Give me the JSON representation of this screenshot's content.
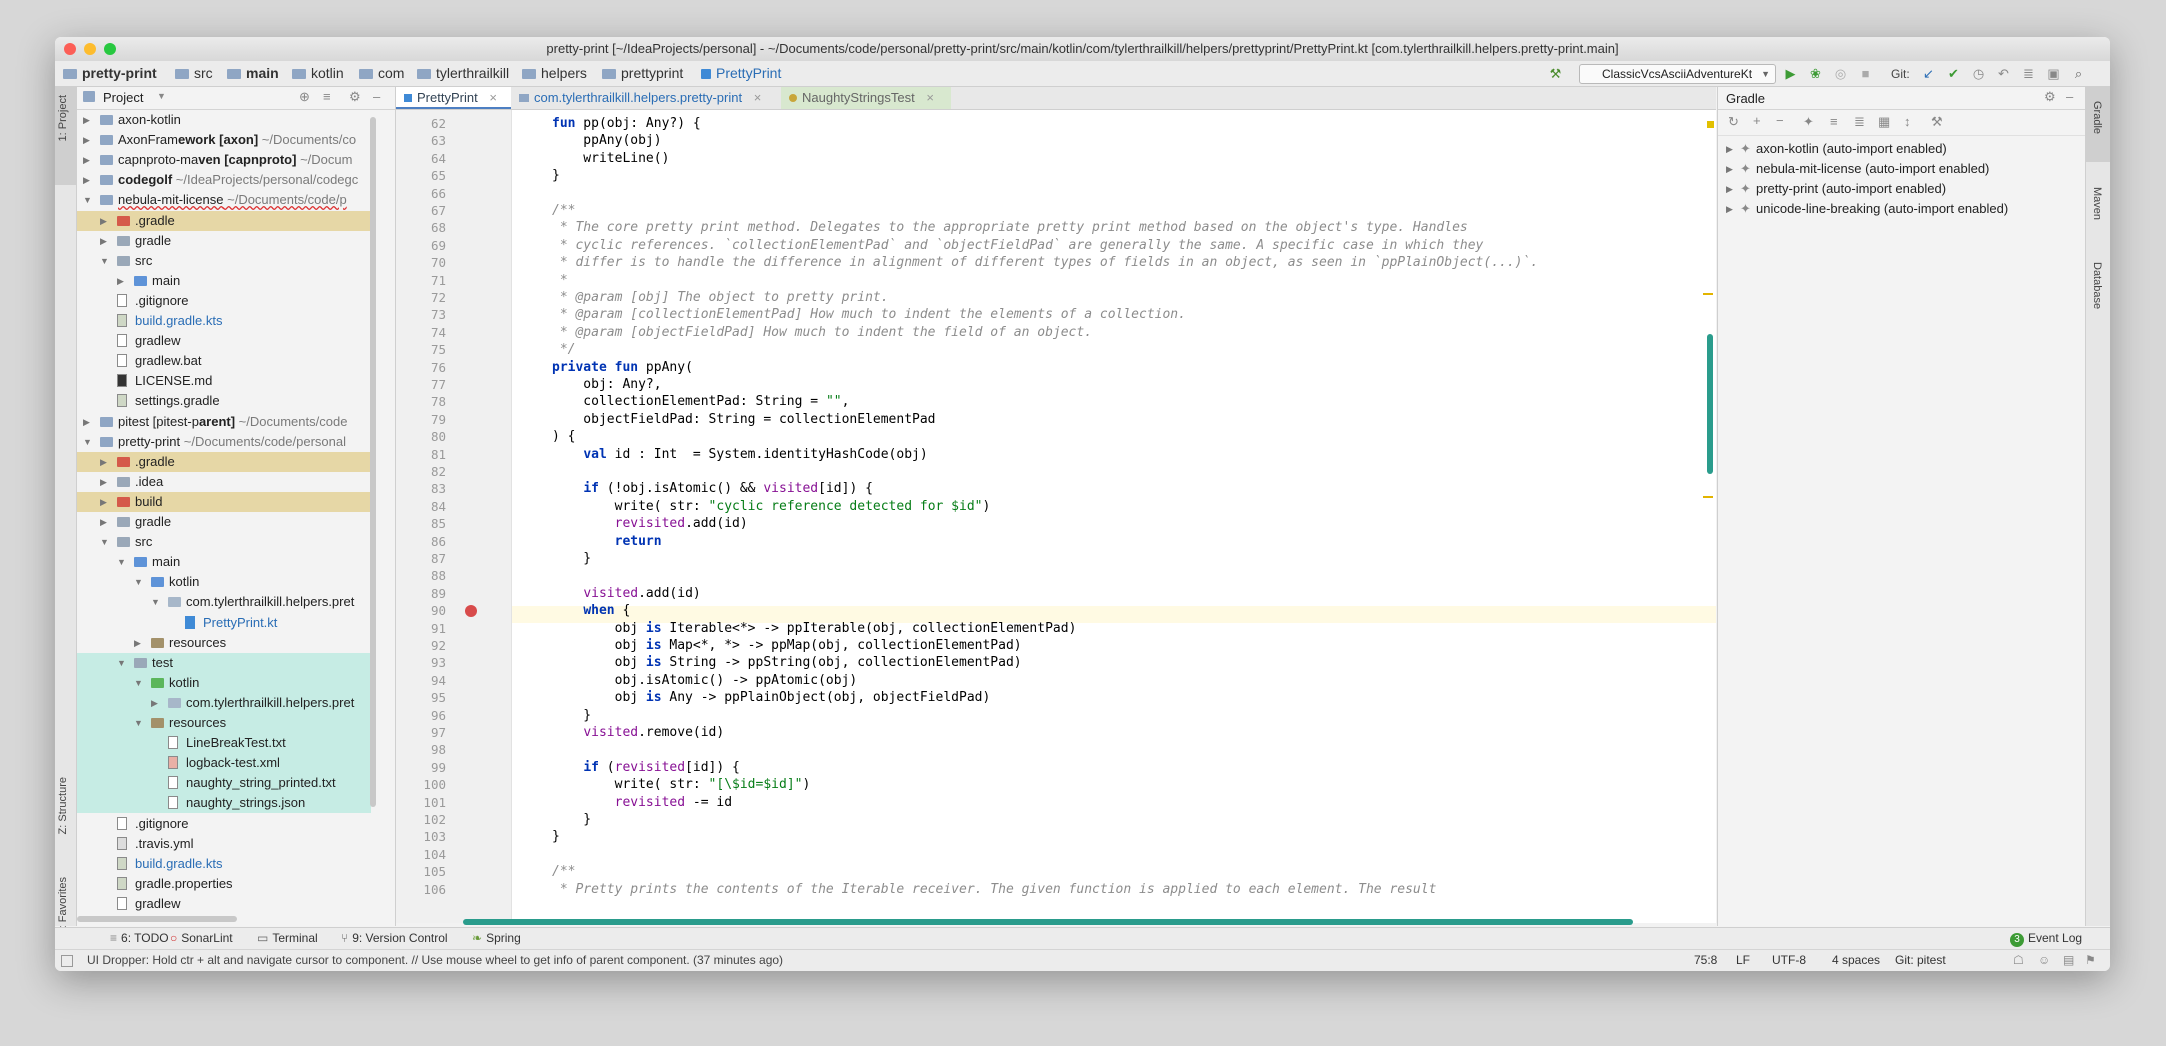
{
  "window": {
    "title": "pretty-print [~/IdeaProjects/personal] - ~/Documents/code/personal/pretty-print/src/main/kotlin/com/tylerthrailkill/helpers/prettyprint/PrettyPrint.kt [com.tylerthrailkill.helpers.pretty-print.main]"
  },
  "breadcrumbs": [
    "pretty-print",
    "src",
    "main",
    "kotlin",
    "com",
    "tylerthrailkill",
    "helpers",
    "prettyprint",
    "PrettyPrint"
  ],
  "toolbar": {
    "run_config": "ClassicVcsAsciiAdventureKt",
    "git_label": "Git:"
  },
  "left_strip": {
    "project": "1: Project",
    "structure": "Z: Structure",
    "favorites": "2: Favorites"
  },
  "project_panel": {
    "title": "Project",
    "tree": [
      {
        "label": "axon-kotlin",
        "extra": ""
      },
      {
        "label": "AxonFramework [axon]",
        "extra": "~/Documents/co"
      },
      {
        "label": "capnproto-maven [capnproto]",
        "extra": "~/Docum"
      },
      {
        "label": "codegolf",
        "extra": "~/IdeaProjects/personal/codegc"
      },
      {
        "label": "nebula-mit-license",
        "extra": "~/Documents/code/p"
      },
      {
        "label": ".gradle",
        "extra": ""
      },
      {
        "label": "gradle",
        "extra": ""
      },
      {
        "label": "src",
        "extra": ""
      },
      {
        "label": "main",
        "extra": ""
      },
      {
        "label": ".gitignore",
        "extra": ""
      },
      {
        "label": "build.gradle.kts",
        "extra": ""
      },
      {
        "label": "gradlew",
        "extra": ""
      },
      {
        "label": "gradlew.bat",
        "extra": ""
      },
      {
        "label": "LICENSE.md",
        "extra": ""
      },
      {
        "label": "settings.gradle",
        "extra": ""
      },
      {
        "label": "pitest [pitest-parent]",
        "extra": "~/Documents/code"
      },
      {
        "label": "pretty-print",
        "extra": "~/Documents/code/personal"
      },
      {
        "label": ".gradle",
        "extra": ""
      },
      {
        "label": ".idea",
        "extra": ""
      },
      {
        "label": "build",
        "extra": ""
      },
      {
        "label": "gradle",
        "extra": ""
      },
      {
        "label": "src",
        "extra": ""
      },
      {
        "label": "main",
        "extra": ""
      },
      {
        "label": "kotlin",
        "extra": ""
      },
      {
        "label": "com.tylerthrailkill.helpers.pret",
        "extra": ""
      },
      {
        "label": "PrettyPrint.kt",
        "extra": ""
      },
      {
        "label": "resources",
        "extra": ""
      },
      {
        "label": "test",
        "extra": ""
      },
      {
        "label": "kotlin",
        "extra": ""
      },
      {
        "label": "com.tylerthrailkill.helpers.pret",
        "extra": ""
      },
      {
        "label": "resources",
        "extra": ""
      },
      {
        "label": "LineBreakTest.txt",
        "extra": ""
      },
      {
        "label": "logback-test.xml",
        "extra": ""
      },
      {
        "label": "naughty_string_printed.txt",
        "extra": ""
      },
      {
        "label": "naughty_strings.json",
        "extra": ""
      },
      {
        "label": ".gitignore",
        "extra": ""
      },
      {
        "label": ".travis.yml",
        "extra": ""
      },
      {
        "label": "build.gradle.kts",
        "extra": ""
      },
      {
        "label": "gradle.properties",
        "extra": ""
      },
      {
        "label": "gradlew",
        "extra": ""
      }
    ]
  },
  "editor_tabs": [
    "PrettyPrint",
    "com.tylerthrailkill.helpers.pretty-print",
    "NaughtyStringsTest"
  ],
  "code_lines": [
    {
      "n": "62",
      "t": "fun pp(obj: Any?) {"
    },
    {
      "n": "63",
      "t": "    ppAny(obj)"
    },
    {
      "n": "64",
      "t": "    writeLine()"
    },
    {
      "n": "65",
      "t": "}"
    },
    {
      "n": "66",
      "t": ""
    },
    {
      "n": "67",
      "t": "/**"
    },
    {
      "n": "68",
      "t": " * The core pretty print method. Delegates to the appropriate pretty print method based on the object's type. Handles"
    },
    {
      "n": "69",
      "t": " * cyclic references. `collectionElementPad` and `objectFieldPad` are generally the same. A specific case in which they"
    },
    {
      "n": "70",
      "t": " * differ is to handle the difference in alignment of different types of fields in an object, as seen in `ppPlainObject(...)`."
    },
    {
      "n": "71",
      "t": " *"
    },
    {
      "n": "72",
      "t": " * @param [obj] The object to pretty print."
    },
    {
      "n": "73",
      "t": " * @param [collectionElementPad] How much to indent the elements of a collection."
    },
    {
      "n": "74",
      "t": " * @param [objectFieldPad] How much to indent the field of an object."
    },
    {
      "n": "75",
      "t": " */"
    },
    {
      "n": "76",
      "t": "private fun ppAny("
    },
    {
      "n": "77",
      "t": "    obj: Any?,"
    },
    {
      "n": "78",
      "t": "    collectionElementPad: String = \"\","
    },
    {
      "n": "79",
      "t": "    objectFieldPad: String = collectionElementPad"
    },
    {
      "n": "80",
      "t": ") {"
    },
    {
      "n": "81",
      "t": "    val id : Int  = System.identityHashCode(obj)"
    },
    {
      "n": "82",
      "t": ""
    },
    {
      "n": "83",
      "t": "    if (!obj.isAtomic() && visited[id]) {"
    },
    {
      "n": "84",
      "t": "        write( str: \"cyclic reference detected for $id\")"
    },
    {
      "n": "85",
      "t": "        revisited.add(id)"
    },
    {
      "n": "86",
      "t": "        return"
    },
    {
      "n": "87",
      "t": "    }"
    },
    {
      "n": "88",
      "t": ""
    },
    {
      "n": "89",
      "t": "    visited.add(id)"
    },
    {
      "n": "90",
      "t": "    when {"
    },
    {
      "n": "91",
      "t": "        obj is Iterable<*> -> ppIterable(obj, collectionElementPad)"
    },
    {
      "n": "92",
      "t": "        obj is Map<*, *> -> ppMap(obj, collectionElementPad)"
    },
    {
      "n": "93",
      "t": "        obj is String -> ppString(obj, collectionElementPad)"
    },
    {
      "n": "94",
      "t": "        obj.isAtomic() -> ppAtomic(obj)"
    },
    {
      "n": "95",
      "t": "        obj is Any -> ppPlainObject(obj, objectFieldPad)"
    },
    {
      "n": "96",
      "t": "    }"
    },
    {
      "n": "97",
      "t": "    visited.remove(id)"
    },
    {
      "n": "98",
      "t": ""
    },
    {
      "n": "99",
      "t": "    if (revisited[id]) {"
    },
    {
      "n": "100",
      "t": "        write( str: \"[\\$id=$id]\")"
    },
    {
      "n": "101",
      "t": "        revisited -= id"
    },
    {
      "n": "102",
      "t": "    }"
    },
    {
      "n": "103",
      "t": "}"
    },
    {
      "n": "104",
      "t": ""
    },
    {
      "n": "105",
      "t": "/**"
    },
    {
      "n": "106",
      "t": " * Pretty prints the contents of the Iterable receiver. The given function is applied to each element. The result"
    }
  ],
  "gradle_panel": {
    "title": "Gradle",
    "projects": [
      "axon-kotlin (auto-import enabled)",
      "nebula-mit-license (auto-import enabled)",
      "pretty-print (auto-import enabled)",
      "unicode-line-breaking (auto-import enabled)"
    ]
  },
  "right_strip": {
    "gradle": "Gradle",
    "maven": "Maven",
    "database": "Database"
  },
  "bottom_tools": [
    "6: TODO",
    "SonarLint",
    "Terminal",
    "9: Version Control",
    "Spring"
  ],
  "event_log": {
    "count": "3",
    "label": "Event Log"
  },
  "status": {
    "message": "UI Dropper: Hold ctr + alt and navigate cursor to component. // Use mouse wheel to get info of parent component. (37 minutes ago)",
    "position": "75:8",
    "line_sep": "LF",
    "encoding": "UTF-8",
    "indent": "4 spaces",
    "git": "Git: pitest"
  }
}
